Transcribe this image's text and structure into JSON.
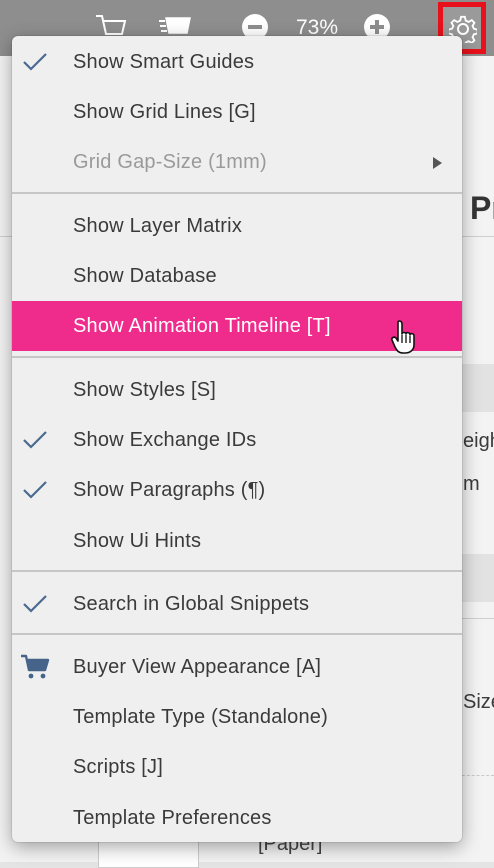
{
  "toolbar": {
    "icons": [
      "cart-icon",
      "cart-fast-icon",
      "zoom-out-icon",
      "zoom-in-icon",
      "gear-icon"
    ],
    "zoom_level": "73%"
  },
  "background": {
    "heading_fragment": "Pr",
    "text_fragment_1": "eigh",
    "text_fragment_2": "m",
    "text_fragment_3": "Size",
    "text_fragment_4": "[Paper]"
  },
  "menu": {
    "items": [
      {
        "label": "Show Smart Guides",
        "checked": true,
        "enabled": true
      },
      {
        "label": "Show Grid Lines [G]",
        "checked": false,
        "enabled": true
      },
      {
        "label": "Grid Gap-Size (1mm)",
        "checked": false,
        "enabled": false,
        "has_submenu": true
      },
      {
        "label": "Show Layer Matrix",
        "checked": false,
        "enabled": true
      },
      {
        "label": "Show Database",
        "checked": false,
        "enabled": true
      },
      {
        "label": "Show Animation Timeline [T]",
        "checked": false,
        "enabled": true,
        "highlighted": true
      },
      {
        "label": "Show Styles [S]",
        "checked": false,
        "enabled": true
      },
      {
        "label": "Show Exchange IDs",
        "checked": true,
        "enabled": true
      },
      {
        "label": "Show Paragraphs (¶)",
        "checked": true,
        "enabled": true
      },
      {
        "label": "Show Ui Hints",
        "checked": false,
        "enabled": true
      },
      {
        "label": "Search in Global Snippets",
        "checked": true,
        "enabled": true
      },
      {
        "label": "Buyer View Appearance [A]",
        "checked": false,
        "enabled": true,
        "icon": "cart-icon"
      },
      {
        "label": "Template Type (Standalone)",
        "checked": false,
        "enabled": true
      },
      {
        "label": "Scripts [J]",
        "checked": false,
        "enabled": true
      },
      {
        "label": "Template Preferences",
        "checked": false,
        "enabled": true
      }
    ]
  },
  "colors": {
    "highlight": "#ef2b8b",
    "settings_outline": "#e8101a",
    "toolbar": "#8e8e8e"
  }
}
